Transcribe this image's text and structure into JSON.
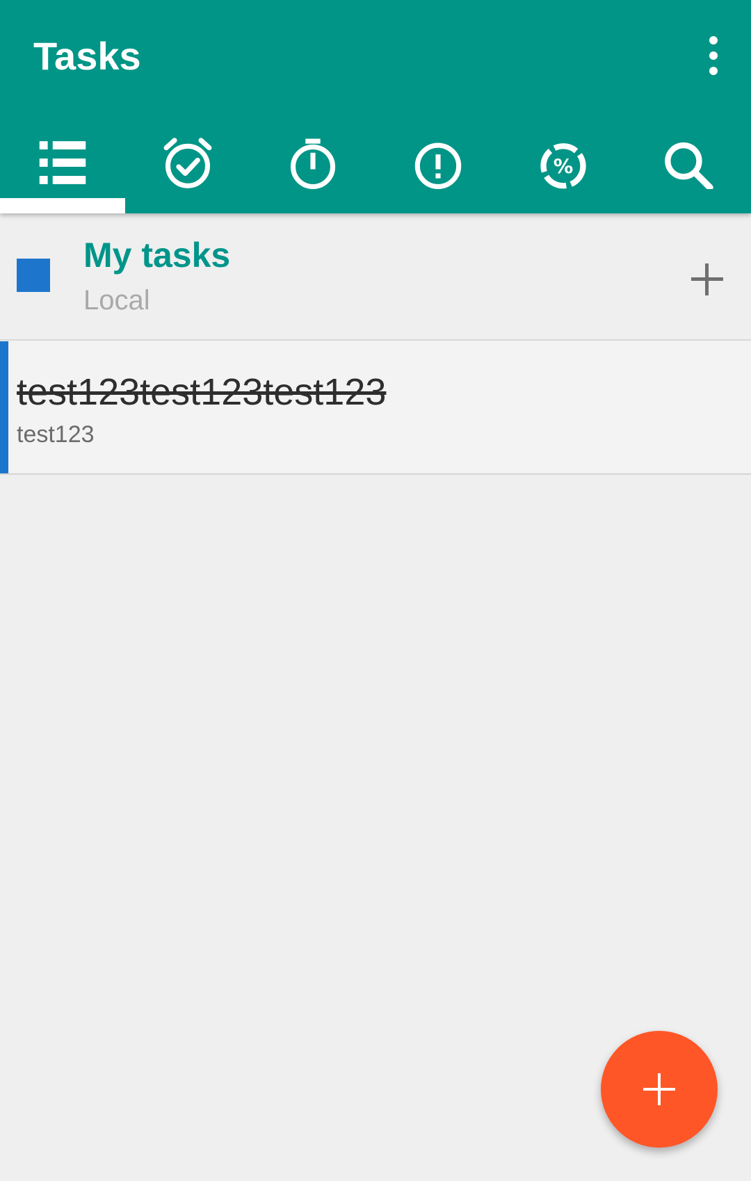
{
  "appbar": {
    "title": "Tasks",
    "background": "#009586",
    "overflow_icon": "more-vert-icon"
  },
  "tabs": [
    {
      "id": "lists",
      "icon": "list-icon",
      "selected": true
    },
    {
      "id": "due",
      "icon": "alarm-check-icon",
      "selected": false
    },
    {
      "id": "started",
      "icon": "timer-icon",
      "selected": false
    },
    {
      "id": "priority",
      "icon": "priority-alert-icon",
      "selected": false
    },
    {
      "id": "progress",
      "icon": "progress-percent-icon",
      "selected": false
    },
    {
      "id": "search",
      "icon": "search-icon",
      "selected": false
    }
  ],
  "list": {
    "name": "My tasks",
    "account": "Local",
    "color": "#1e76cc",
    "add_icon": "plus-icon"
  },
  "tasks": [
    {
      "title": "test123test123test123",
      "description": "test123",
      "completed": true,
      "color": "#1e76cc"
    }
  ],
  "fab": {
    "icon": "plus-icon",
    "color": "#ff5627"
  }
}
